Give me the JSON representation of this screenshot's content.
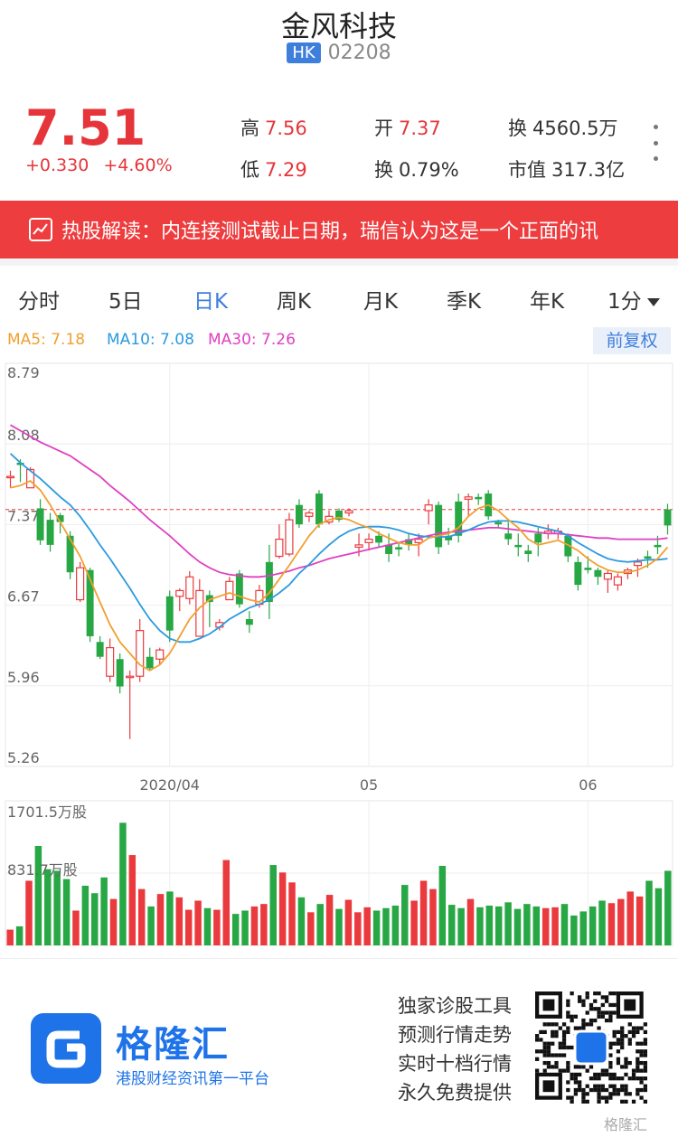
{
  "header": {
    "title": "金风科技",
    "market": "HK",
    "code": "02208"
  },
  "quote": {
    "price": "7.51",
    "change": "+0.330",
    "change_pct": "+4.60%",
    "high_label": "高",
    "high": "7.56",
    "open_label": "开",
    "open": "7.37",
    "vol_label": "换",
    "vol": "4560.5万",
    "low_label": "低",
    "low": "7.29",
    "turnover_label": "换",
    "turnover": "0.79%",
    "mcap_label": "市值",
    "mcap": "317.3亿"
  },
  "banner": {
    "text": "热股解读：内连接测试截止日期，瑞信认为这是一个正面的讯"
  },
  "tabs": [
    "分时",
    "5日",
    "日K",
    "周K",
    "月K",
    "季K",
    "年K",
    "1分"
  ],
  "active_tab": 2,
  "ma": {
    "ma5": "MA5: 7.18",
    "ma10": "MA10: 7.08",
    "ma30": "MA30: 7.26",
    "adjust_label": "前复权"
  },
  "colors": {
    "up": "#ea3a3e",
    "down": "#28a745",
    "ma5": "#f0a030",
    "ma10": "#2b9ae0",
    "ma30": "#e040c0",
    "accent": "#3f7fdc"
  },
  "chart_data": {
    "type": "candlestick",
    "y_ticks": [
      "8.79",
      "8.08",
      "7.37",
      "6.67",
      "5.96",
      "5.26"
    ],
    "ylim": [
      5.26,
      8.79
    ],
    "x_labels": [
      {
        "index": 16,
        "label": "2020/04"
      },
      {
        "index": 36,
        "label": "05"
      },
      {
        "index": 58,
        "label": "06"
      }
    ],
    "reference_price": 7.51,
    "candles": [
      [
        7.8,
        7.85,
        7.7,
        7.8
      ],
      [
        7.92,
        7.95,
        7.75,
        7.9
      ],
      [
        7.7,
        7.88,
        7.75,
        7.86
      ],
      [
        7.52,
        7.6,
        7.2,
        7.24
      ],
      [
        7.42,
        7.48,
        7.14,
        7.2
      ],
      [
        7.46,
        7.48,
        7.3,
        7.4
      ],
      [
        7.28,
        7.32,
        6.9,
        6.96
      ],
      [
        6.72,
        7.05,
        6.7,
        7.0
      ],
      [
        6.98,
        7.0,
        6.35,
        6.4
      ],
      [
        6.35,
        6.4,
        6.2,
        6.22
      ],
      [
        6.05,
        6.38,
        6.0,
        6.3
      ],
      [
        6.2,
        6.25,
        5.9,
        5.96
      ],
      [
        6.05,
        6.1,
        5.5,
        6.05
      ],
      [
        6.05,
        6.55,
        6.0,
        6.45
      ],
      [
        6.22,
        6.3,
        6.1,
        6.12
      ],
      [
        6.2,
        6.3,
        6.15,
        6.28
      ],
      [
        6.75,
        6.8,
        6.35,
        6.45
      ],
      [
        6.75,
        6.82,
        6.62,
        6.8
      ],
      [
        6.73,
        6.97,
        6.68,
        6.92
      ],
      [
        6.4,
        6.9,
        6.7,
        6.8
      ],
      [
        6.76,
        6.8,
        6.48,
        6.7
      ],
      [
        6.48,
        6.55,
        6.45,
        6.52
      ],
      [
        6.72,
        6.92,
        6.72,
        6.88
      ],
      [
        6.95,
        6.98,
        6.65,
        6.68
      ],
      [
        6.55,
        6.62,
        6.43,
        6.5
      ],
      [
        6.68,
        6.85,
        6.65,
        6.8
      ],
      [
        7.05,
        7.2,
        6.55,
        6.7
      ],
      [
        7.1,
        7.38,
        7.08,
        7.25
      ],
      [
        7.12,
        7.48,
        7.1,
        7.42
      ],
      [
        7.55,
        7.6,
        7.35,
        7.38
      ],
      [
        7.45,
        7.5,
        7.4,
        7.48
      ],
      [
        7.65,
        7.68,
        7.35,
        7.38
      ],
      [
        7.4,
        7.5,
        7.38,
        7.45
      ],
      [
        7.5,
        7.52,
        7.4,
        7.42
      ],
      [
        7.48,
        7.52,
        7.45,
        7.5
      ],
      [
        7.18,
        7.3,
        7.1,
        7.2
      ],
      [
        7.22,
        7.3,
        7.15,
        7.25
      ],
      [
        7.28,
        7.32,
        7.18,
        7.22
      ],
      [
        7.2,
        7.3,
        7.05,
        7.12
      ],
      [
        7.18,
        7.22,
        7.1,
        7.16
      ],
      [
        7.25,
        7.3,
        7.15,
        7.2
      ],
      [
        7.22,
        7.3,
        7.1,
        7.25
      ],
      [
        7.5,
        7.6,
        7.38,
        7.55
      ],
      [
        7.55,
        7.58,
        7.12,
        7.18
      ],
      [
        7.28,
        7.35,
        7.2,
        7.24
      ],
      [
        7.58,
        7.65,
        7.22,
        7.28
      ],
      [
        7.6,
        7.65,
        7.45,
        7.62
      ],
      [
        7.62,
        7.65,
        7.55,
        7.6
      ],
      [
        7.65,
        7.68,
        7.42,
        7.45
      ],
      [
        7.4,
        7.42,
        7.35,
        7.38
      ],
      [
        7.3,
        7.4,
        7.2,
        7.25
      ],
      [
        7.2,
        7.3,
        7.1,
        7.18
      ],
      [
        7.15,
        7.2,
        7.05,
        7.12
      ],
      [
        7.3,
        7.35,
        7.1,
        7.22
      ],
      [
        7.3,
        7.38,
        7.25,
        7.32
      ],
      [
        7.3,
        7.35,
        7.25,
        7.32
      ],
      [
        7.28,
        7.3,
        7.05,
        7.1
      ],
      [
        7.05,
        7.1,
        6.8,
        6.85
      ],
      [
        7.0,
        7.1,
        6.95,
        6.98
      ],
      [
        6.98,
        7.0,
        6.85,
        6.92
      ],
      [
        6.9,
        6.98,
        6.78,
        6.95
      ],
      [
        6.85,
        6.95,
        6.8,
        6.92
      ],
      [
        6.95,
        7.0,
        6.9,
        6.98
      ],
      [
        7.02,
        7.08,
        6.92,
        7.05
      ],
      [
        7.1,
        7.15,
        7.0,
        7.08
      ],
      [
        7.2,
        7.28,
        7.12,
        7.18
      ],
      [
        7.51,
        7.56,
        7.29,
        7.37
      ]
    ],
    "ma5": [
      7.7,
      7.72,
      7.76,
      7.68,
      7.55,
      7.4,
      7.25,
      7.1,
      6.9,
      6.7,
      6.5,
      6.35,
      6.25,
      6.15,
      6.1,
      6.15,
      6.25,
      6.4,
      6.55,
      6.65,
      6.72,
      6.75,
      6.78,
      6.75,
      6.72,
      6.7,
      6.78,
      6.9,
      7.02,
      7.15,
      7.28,
      7.38,
      7.42,
      7.44,
      7.42,
      7.38,
      7.35,
      7.3,
      7.26,
      7.22,
      7.2,
      7.2,
      7.26,
      7.28,
      7.3,
      7.35,
      7.45,
      7.52,
      7.55,
      7.5,
      7.42,
      7.35,
      7.25,
      7.2,
      7.22,
      7.24,
      7.2,
      7.15,
      7.08,
      7.02,
      6.98,
      6.96,
      6.96,
      6.98,
      7.02,
      7.08,
      7.18
    ],
    "ma10": [
      8.0,
      7.92,
      7.85,
      7.78,
      7.7,
      7.62,
      7.55,
      7.45,
      7.33,
      7.2,
      7.08,
      6.95,
      6.82,
      6.68,
      6.55,
      6.45,
      6.38,
      6.35,
      6.35,
      6.38,
      6.42,
      6.48,
      6.55,
      6.6,
      6.65,
      6.68,
      6.72,
      6.78,
      6.85,
      6.95,
      7.03,
      7.12,
      7.2,
      7.27,
      7.32,
      7.35,
      7.36,
      7.36,
      7.35,
      7.33,
      7.3,
      7.28,
      7.27,
      7.27,
      7.27,
      7.3,
      7.33,
      7.37,
      7.4,
      7.41,
      7.41,
      7.4,
      7.38,
      7.36,
      7.34,
      7.32,
      7.28,
      7.22,
      7.17,
      7.12,
      7.08,
      7.06,
      7.05,
      7.06,
      7.07,
      7.07,
      7.08
    ],
    "ma30": [
      8.25,
      8.2,
      8.15,
      8.1,
      8.06,
      8.02,
      7.98,
      7.92,
      7.86,
      7.8,
      7.72,
      7.65,
      7.58,
      7.5,
      7.42,
      7.35,
      7.28,
      7.2,
      7.12,
      7.05,
      7.0,
      6.96,
      6.94,
      6.93,
      6.92,
      6.92,
      6.93,
      6.95,
      6.97,
      7.0,
      7.02,
      7.05,
      7.08,
      7.1,
      7.12,
      7.14,
      7.16,
      7.18,
      7.2,
      7.22,
      7.24,
      7.26,
      7.28,
      7.3,
      7.31,
      7.32,
      7.33,
      7.34,
      7.35,
      7.35,
      7.34,
      7.33,
      7.32,
      7.31,
      7.3,
      7.3,
      7.29,
      7.28,
      7.27,
      7.26,
      7.26,
      7.25,
      7.25,
      7.25,
      7.25,
      7.25,
      7.26
    ],
    "volume_ticks": [
      "1701.5万股",
      "831.7万股"
    ],
    "volume_max": 1701.5,
    "volumes": [
      190,
      230,
      780,
      1200,
      920,
      900,
      800,
      420,
      720,
      630,
      820,
      560,
      1480,
      1090,
      680,
      470,
      620,
      650,
      580,
      430,
      540,
      450,
      430,
      1030,
      380,
      420,
      470,
      500,
      970,
      880,
      760,
      580,
      400,
      500,
      610,
      440,
      550,
      400,
      460,
      420,
      450,
      480,
      730,
      540,
      780,
      680,
      960,
      490,
      450,
      560,
      460,
      480,
      470,
      520,
      440,
      500,
      470,
      450,
      460,
      500,
      360,
      410,
      470,
      540,
      510,
      560,
      650,
      590,
      780,
      690,
      900
    ]
  },
  "footer": {
    "logo_text": "格隆汇",
    "slogan": "港股财经资讯第一平台",
    "promo": [
      "独家诊股工具",
      "预测行情走势",
      "实时十档行情",
      "永久免费提供"
    ],
    "watermark": "格隆汇"
  }
}
